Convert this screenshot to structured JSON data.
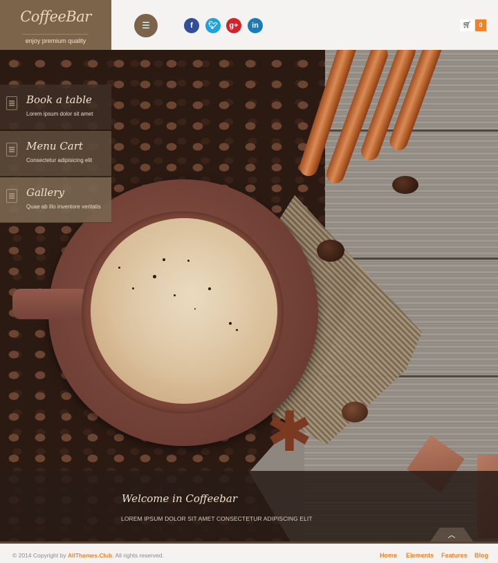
{
  "header": {
    "logo_title": "CoffeeBar",
    "logo_tagline": "enjoy premium quality",
    "menu_icon": "hamburger-icon",
    "social": [
      {
        "name": "facebook",
        "glyph": "f",
        "color": "#2f4f98"
      },
      {
        "name": "twitter",
        "glyph": "t",
        "color": "#1da1e0"
      },
      {
        "name": "google-plus",
        "glyph": "g+",
        "color": "#d0232b"
      },
      {
        "name": "linkedin",
        "glyph": "in",
        "color": "#1a7bb9"
      }
    ],
    "cart_icon": "shopping-cart-icon",
    "cart_count": "0"
  },
  "side_menu": [
    {
      "title": "Book a table",
      "subtitle": "Lorem ipsum dolor sit amet",
      "icon": "document-icon",
      "bg": "rgba(62,46,36,0.88)"
    },
    {
      "title": "Menu Cart",
      "subtitle": "Consectetur adipisicing elit",
      "icon": "list-document-icon",
      "bg": "rgba(92,74,58,0.9)"
    },
    {
      "title": "Gallery",
      "subtitle": "Quae ab illo inventore veritatis",
      "icon": "image-icon",
      "bg": "rgba(122,102,80,0.9)"
    }
  ],
  "welcome": {
    "title": "Welcome in Coffeebar",
    "subtitle": "LOREM IPSUM DOLOR SIT AMET CONSECTETUR ADIPISCING ELIT"
  },
  "footer": {
    "copyright_prefix": "© 2014 Copyright by ",
    "copyright_link": "AllThemes.Club",
    "copyright_suffix": ". All rights reserved.",
    "links": [
      "Home",
      "Elements",
      "Features",
      "Blog"
    ]
  },
  "colors": {
    "brand_brown": "#7b6449",
    "accent_orange": "#f0822a"
  }
}
